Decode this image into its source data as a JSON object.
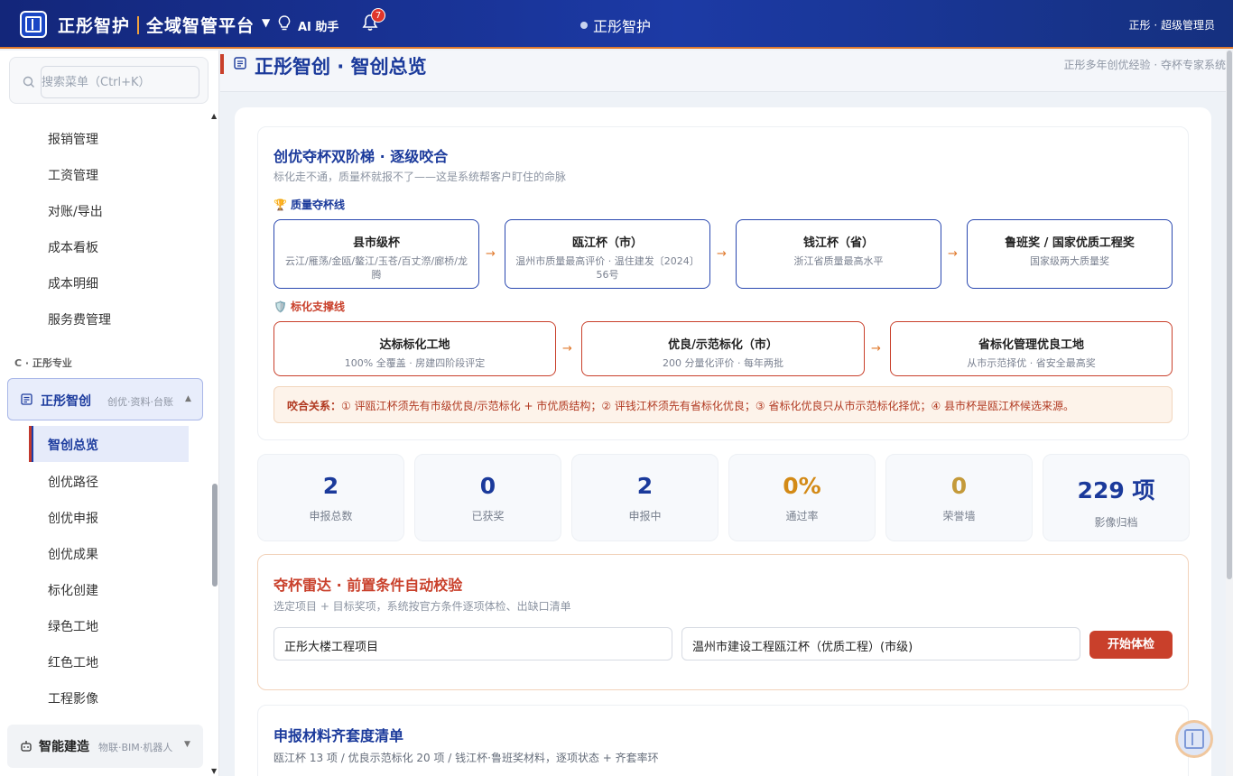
{
  "header": {
    "brand_main": "正彤智护",
    "brand_sub": "全域智管平台",
    "ai_label": "AI 助手",
    "notification_count": "7",
    "center_title": "正彤智护",
    "user": "正彤 · 超级管理员"
  },
  "sidebar": {
    "search_placeholder": "搜索菜单（Ctrl+K）",
    "items_top": [
      "报销管理",
      "工资管理",
      "对账/导出",
      "成本看板",
      "成本明细",
      "服务费管理"
    ],
    "group_label": "C · 正彤专业",
    "active_group": {
      "title": "正彤智创",
      "subtitle": "创优·资料·台账"
    },
    "active_item": "智创总览",
    "sub_items": [
      "创优路径",
      "创优申报",
      "创优成果",
      "标化创建",
      "绿色工地",
      "红色工地",
      "工程影像"
    ],
    "next_group": {
      "title": "智能建造",
      "subtitle": "物联·BIM·机器人"
    }
  },
  "page": {
    "title": "正彤智创 · 智创总览",
    "subtitle": "正彤多年创优经验 · 夺杯专家系统"
  },
  "ladder": {
    "title": "创优夺杯双阶梯 · 逐级咬合",
    "subtitle": "标化走不通，质量杯就报不了——这是系统帮客户盯住的命脉",
    "quality_label": "质量夺杯线",
    "quality_steps": [
      {
        "title": "县市级杯",
        "desc": "云江/雁荡/金瓯/鳌江/玉苍/百丈漈/廊桥/龙腾"
      },
      {
        "title": "瓯江杯（市）",
        "desc": "温州市质量最高评价 · 温住建发〔2024〕56号"
      },
      {
        "title": "钱江杯（省）",
        "desc": "浙江省质量最高水平"
      },
      {
        "title": "鲁班奖 / 国家优质工程奖",
        "desc": "国家级两大质量奖"
      }
    ],
    "standard_label": "标化支撑线",
    "standard_steps": [
      {
        "title": "达标标化工地",
        "desc": "100% 全覆盖 · 房建四阶段评定"
      },
      {
        "title": "优良/示范标化（市）",
        "desc": "200 分量化评价 · 每年两批"
      },
      {
        "title": "省标化管理优良工地",
        "desc": "从市示范择优 · 省安全最高奖"
      }
    ],
    "relation_label": "咬合关系：",
    "relation_text": "① 评瓯江杯须先有市级优良/示范标化 + 市优质结构；② 评钱江杯须先有省标化优良；③ 省标化优良只从市示范标化择优；④ 县市杯是瓯江杯候选来源。"
  },
  "stats": [
    {
      "value": "2",
      "label": "申报总数",
      "color": "#1b3a9b"
    },
    {
      "value": "0",
      "label": "已获奖",
      "color": "#1b3a9b"
    },
    {
      "value": "2",
      "label": "申报中",
      "color": "#1b3a9b"
    },
    {
      "value": "0%",
      "label": "通过率",
      "color": "#d38a16"
    },
    {
      "value": "0",
      "label": "荣誉墙",
      "color": "#c49a3a"
    },
    {
      "value": "229 项",
      "label": "影像归档",
      "color": "#1b3a9b"
    }
  ],
  "radar": {
    "title": "夺杯雷达 · 前置条件自动校验",
    "subtitle": "选定项目 + 目标奖项，系统按官方条件逐项体检、出缺口清单",
    "project_value": "正彤大楼工程项目",
    "award_value": "温州市建设工程瓯江杯（优质工程）(市级)",
    "button": "开始体检"
  },
  "checklist": {
    "title": "申报材料齐套度清单",
    "subtitle": "瓯江杯 13 项 / 优良示范标化 20 项 / 钱江杯·鲁班奖材料，逐项状态 + 齐套率环"
  }
}
